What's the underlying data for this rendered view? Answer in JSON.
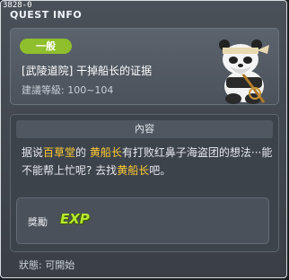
{
  "window": {
    "id_label": "3828-0",
    "title": "QUEST INFO"
  },
  "quest": {
    "category_badge": "一般",
    "name": "[武陵道院] 干掉船长的证据",
    "level": "建議等級: 100~104"
  },
  "content": {
    "header": "內容",
    "text_parts": [
      {
        "text": "据说",
        "highlight": false
      },
      {
        "text": "百草堂",
        "highlight": true
      },
      {
        "text": "的 ",
        "highlight": false
      },
      {
        "text": "黄船长",
        "highlight": true
      },
      {
        "text": "有打败红鼻子海盗团的想法···能不能帮上忙呢? 去找",
        "highlight": false
      },
      {
        "text": "黄船长",
        "highlight": true
      },
      {
        "text": "吧。",
        "highlight": false
      }
    ]
  },
  "reward": {
    "label": "獎勵",
    "type": "EXP"
  },
  "status": {
    "text": "狀態: 可開始"
  },
  "colors": {
    "badge": "#8fbf2c",
    "highlight": "#ffcc33",
    "exp": "#b6e82e"
  }
}
